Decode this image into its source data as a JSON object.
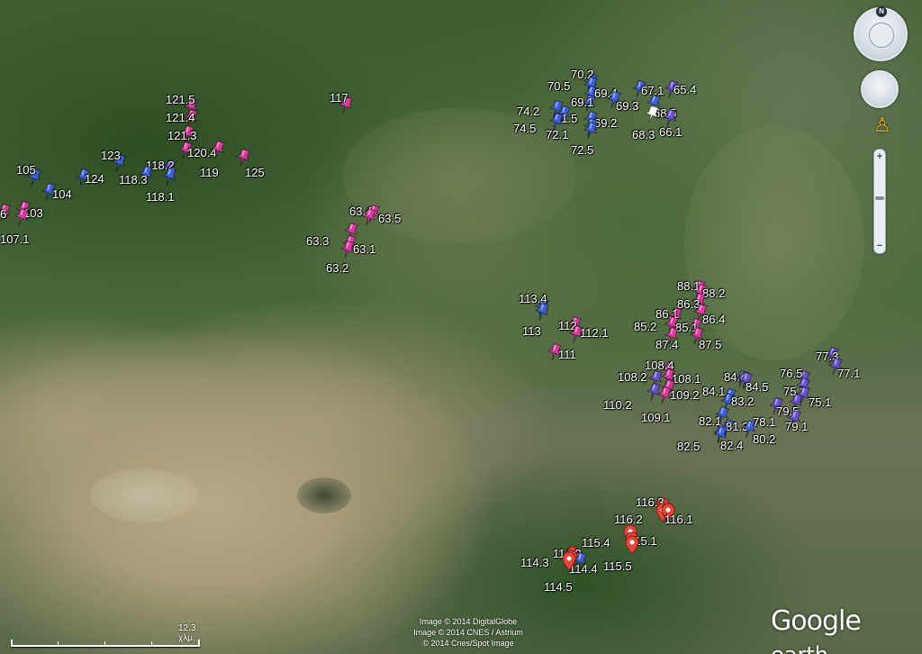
{
  "pin_colors": {
    "blue": "#3f5fd6",
    "pink": "#d63a9a",
    "purple": "#6a4fcf",
    "red": "#e0473a",
    "white": "#ffffff"
  },
  "markers": [
    {
      "label": "121.5",
      "color": "pink"
    },
    {
      "label": "121.4",
      "color": "pink"
    },
    {
      "label": "121.3",
      "color": "pink"
    },
    {
      "label": "120.4",
      "color": "pink"
    },
    {
      "label": "119",
      "color": "pink"
    },
    {
      "label": "125",
      "color": "pink"
    },
    {
      "label": "123",
      "color": "blue"
    },
    {
      "label": "118.2",
      "color": "purple"
    },
    {
      "label": "118.3",
      "color": "blue"
    },
    {
      "label": "118.1",
      "color": "blue"
    },
    {
      "label": "124",
      "color": "blue"
    },
    {
      "label": "105",
      "color": "blue"
    },
    {
      "label": "104",
      "color": "blue"
    },
    {
      "label": "103",
      "color": "pink"
    },
    {
      "label": "107.1",
      "color": "pink"
    },
    {
      "label": "6",
      "color": "pink"
    },
    {
      "label": "117",
      "color": "pink"
    },
    {
      "label": "63.4",
      "color": "pink"
    },
    {
      "label": "63.5",
      "color": "pink"
    },
    {
      "label": "63.3",
      "color": "pink"
    },
    {
      "label": "63.1",
      "color": "pink"
    },
    {
      "label": "63.2",
      "color": "pink"
    },
    {
      "label": "70.2",
      "color": "blue"
    },
    {
      "label": "70.5",
      "color": "blue"
    },
    {
      "label": "69.4",
      "color": "blue"
    },
    {
      "label": "67.1",
      "color": "blue"
    },
    {
      "label": "65.4",
      "color": "purple"
    },
    {
      "label": "69.1",
      "color": "blue"
    },
    {
      "label": "69.3",
      "color": "blue"
    },
    {
      "label": "68.5",
      "color": "blue"
    },
    {
      "label": "74.2",
      "color": "blue"
    },
    {
      "label": "71.5",
      "color": "blue"
    },
    {
      "label": "69.2",
      "color": "blue"
    },
    {
      "label": "74.5",
      "color": "blue"
    },
    {
      "label": "72.1",
      "color": "blue"
    },
    {
      "label": "68.3",
      "color": "white"
    },
    {
      "label": "66.1",
      "color": "purple"
    },
    {
      "label": "72.5",
      "color": "blue"
    },
    {
      "label": "113.4",
      "color": "blue"
    },
    {
      "label": "113",
      "color": "blue"
    },
    {
      "label": "112",
      "color": "pink"
    },
    {
      "label": "112.1",
      "color": "pink"
    },
    {
      "label": "111",
      "color": "pink"
    },
    {
      "label": "88.1",
      "color": "pink"
    },
    {
      "label": "88.2",
      "color": "pink"
    },
    {
      "label": "86.3",
      "color": "pink"
    },
    {
      "label": "86.1",
      "color": "pink"
    },
    {
      "label": "86.4",
      "color": "pink"
    },
    {
      "label": "85.2",
      "color": "pink"
    },
    {
      "label": "85.1",
      "color": "pink"
    },
    {
      "label": "87.4",
      "color": "pink"
    },
    {
      "label": "87.5",
      "color": "pink"
    },
    {
      "label": "108.4",
      "color": "pink"
    },
    {
      "label": "108.2",
      "color": "purple"
    },
    {
      "label": "108.1",
      "color": "pink"
    },
    {
      "label": "109.2",
      "color": "pink"
    },
    {
      "label": "110.2",
      "color": "purple"
    },
    {
      "label": "109.1",
      "color": "pink"
    },
    {
      "label": "84.4",
      "color": "purple"
    },
    {
      "label": "84.5",
      "color": "purple"
    },
    {
      "label": "84.1",
      "color": "blue"
    },
    {
      "label": "83.2",
      "color": "blue"
    },
    {
      "label": "82.1",
      "color": "blue"
    },
    {
      "label": "81.3",
      "color": "blue"
    },
    {
      "label": "82.5",
      "color": "blue"
    },
    {
      "label": "82.4",
      "color": "blue"
    },
    {
      "label": "80.2",
      "color": "blue"
    },
    {
      "label": "78.1",
      "color": "purple"
    },
    {
      "label": "77.3",
      "color": "purple"
    },
    {
      "label": "77.1",
      "color": "purple"
    },
    {
      "label": "76.5",
      "color": "purple"
    },
    {
      "label": "75.3",
      "color": "purple"
    },
    {
      "label": "75.1",
      "color": "purple"
    },
    {
      "label": "79.5",
      "color": "purple"
    },
    {
      "label": "79.1",
      "color": "purple"
    },
    {
      "label": "116.3",
      "color": "red"
    },
    {
      "label": "116.2",
      "color": "red"
    },
    {
      "label": "116.1",
      "color": "red"
    },
    {
      "label": "115.4",
      "color": "red"
    },
    {
      "label": "115.1",
      "color": "red"
    },
    {
      "label": "115.5",
      "color": "red"
    },
    {
      "label": "114.2",
      "color": "red"
    },
    {
      "label": "114.3",
      "color": "red"
    },
    {
      "label": "114.4",
      "color": "blue"
    },
    {
      "label": "114.5",
      "color": "red"
    }
  ],
  "controls": {
    "compass_icon": "compass-icon",
    "compass_north": "N",
    "look_icon": "look-joystick-icon",
    "pegman_icon": "street-view-pegman-icon",
    "zoom_in": "+",
    "zoom_out": "−",
    "zoom_level": 0.45
  },
  "attribution": {
    "line1": "Image © 2014 DigitalGlobe",
    "line2": "Image © 2014 CNES / Astrium",
    "line3": "© 2014 Cnes/Spot Image"
  },
  "scale_bar": {
    "label": "12.3 χλμ."
  },
  "logo": {
    "google": "Google",
    "earth": "earth"
  }
}
